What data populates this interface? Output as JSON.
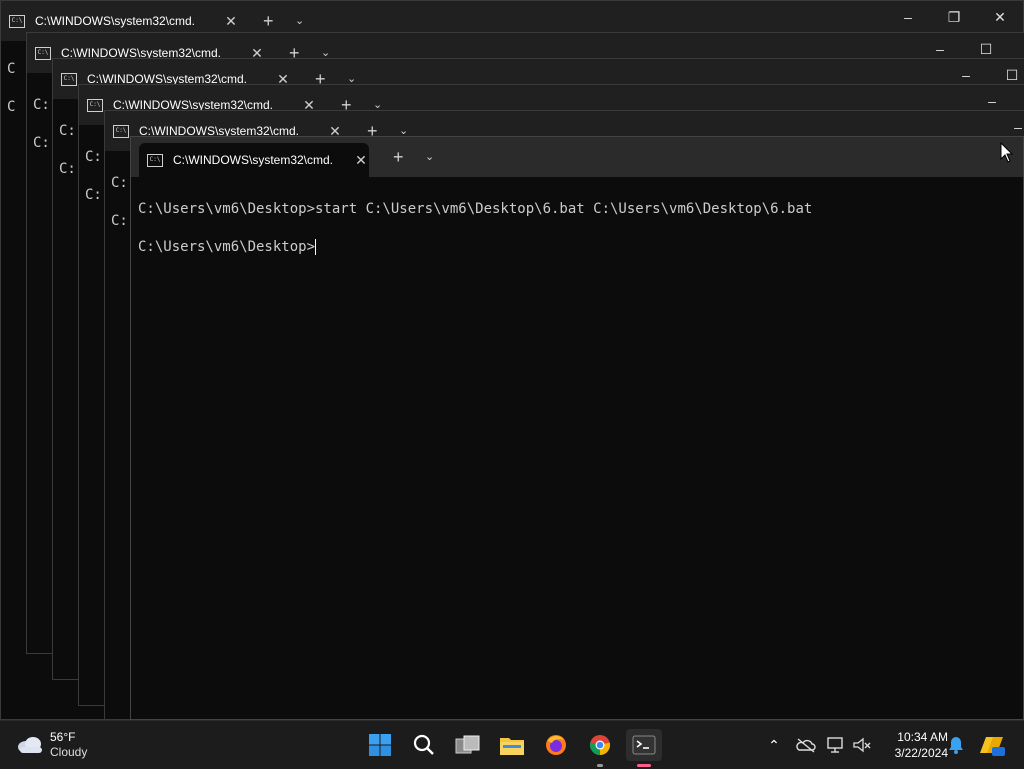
{
  "windows": [
    {
      "title": "C:\\WINDOWS\\system32\\cmd.",
      "prompt_peek": "C"
    },
    {
      "title": "C:\\WINDOWS\\system32\\cmd.",
      "prompt_peek": "C:"
    },
    {
      "title": "C:\\WINDOWS\\system32\\cmd.",
      "prompt_peek": "C:"
    },
    {
      "title": "C:\\WINDOWS\\system32\\cmd.",
      "prompt_peek": "C:"
    },
    {
      "title": "C:\\WINDOWS\\system32\\cmd.",
      "prompt_peek": "C:"
    },
    {
      "title": "C:\\WINDOWS\\system32\\cmd."
    }
  ],
  "active_terminal": {
    "line1": "C:\\Users\\vm6\\Desktop>start C:\\Users\\vm6\\Desktop\\6.bat C:\\Users\\vm6\\Desktop\\6.bat",
    "line2": "C:\\Users\\vm6\\Desktop>"
  },
  "taskbar": {
    "weather": {
      "temp": "56°F",
      "condition": "Cloudy",
      "icon": "cloud-icon"
    },
    "apps": [
      "start-icon",
      "search-icon",
      "task-view-icon",
      "file-explorer-icon",
      "firefox-icon",
      "chrome-icon",
      "terminal-icon"
    ],
    "clock": {
      "time": "10:34 AM",
      "date": "3/22/2024"
    }
  },
  "colors": {
    "accent": "#0078d4",
    "terminal_bg": "#0c0c0c",
    "titlebar_bg": "#202020"
  }
}
